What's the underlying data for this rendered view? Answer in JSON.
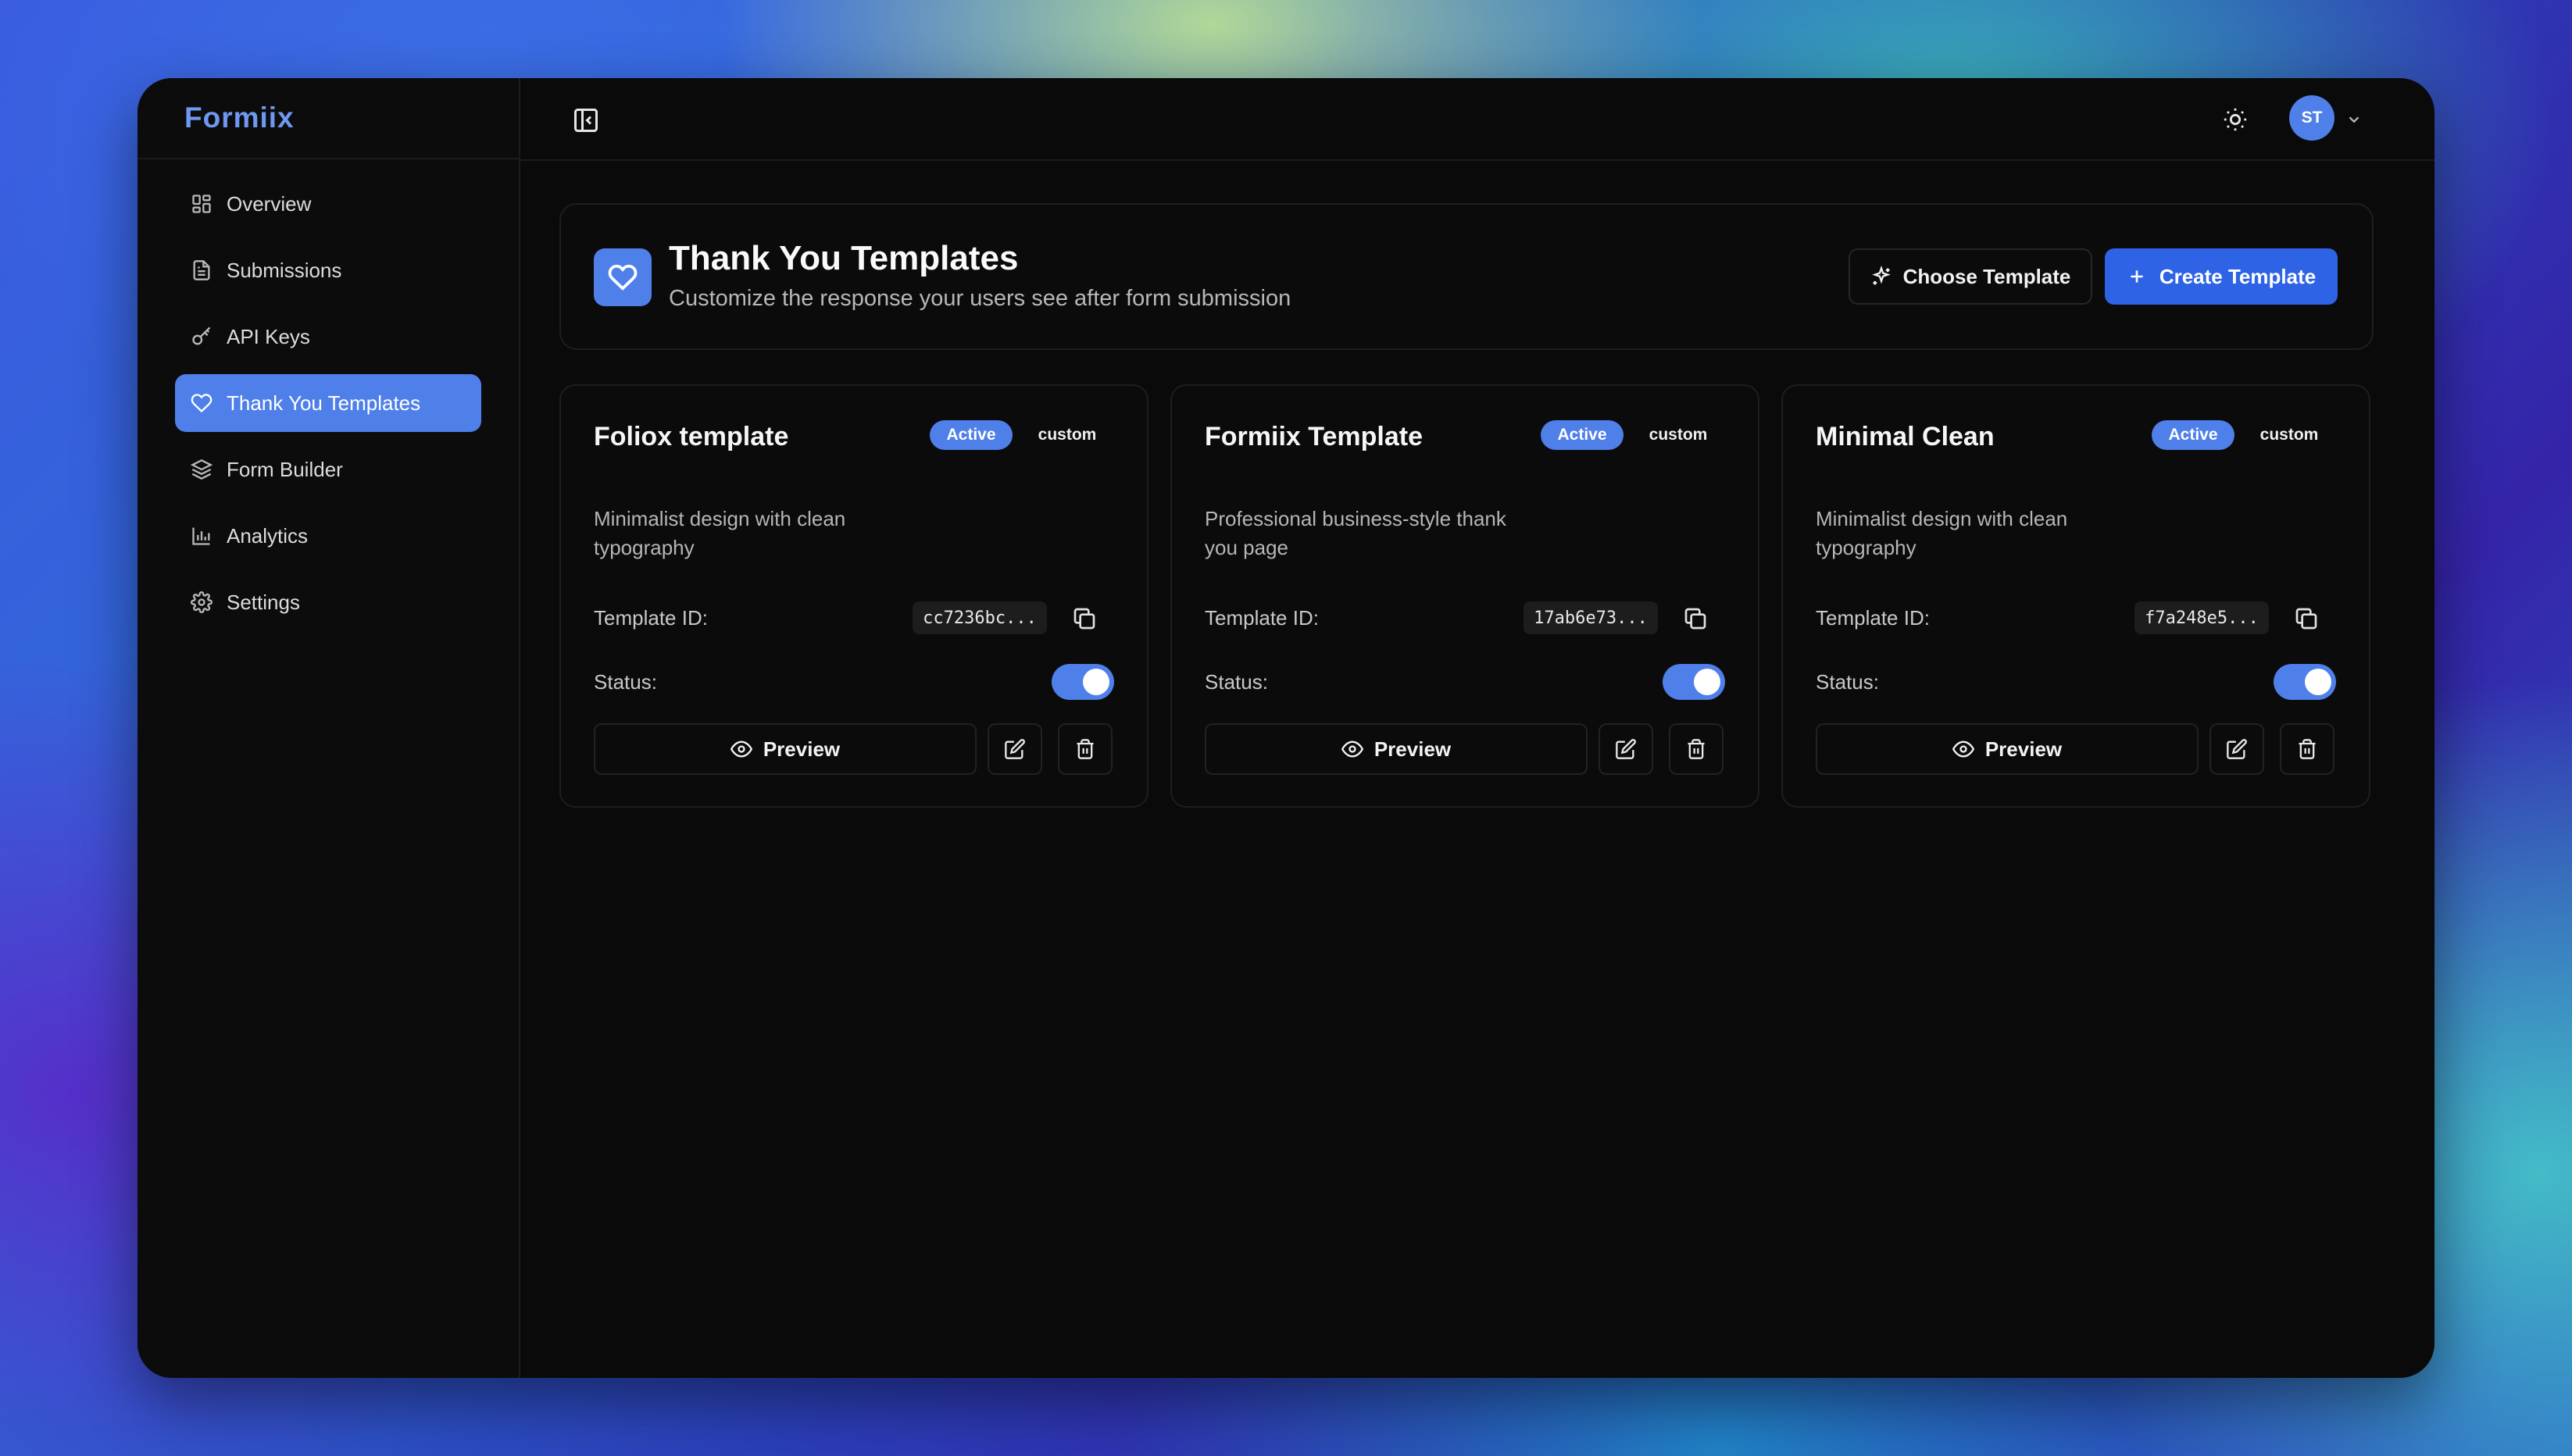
{
  "app": {
    "brand": "Formiix"
  },
  "sidebar": {
    "items": [
      {
        "label": "Overview",
        "icon": "grid-icon",
        "active": false
      },
      {
        "label": "Submissions",
        "icon": "document-icon",
        "active": false
      },
      {
        "label": "API Keys",
        "icon": "key-icon",
        "active": false
      },
      {
        "label": "Thank You Templates",
        "icon": "heart-icon",
        "active": true
      },
      {
        "label": "Form Builder",
        "icon": "layers-icon",
        "active": false
      },
      {
        "label": "Analytics",
        "icon": "bar-chart-icon",
        "active": false
      },
      {
        "label": "Settings",
        "icon": "gear-icon",
        "active": false
      }
    ]
  },
  "topbar": {
    "avatar_initials": "ST",
    "theme_icon": "sun-icon"
  },
  "header": {
    "title": "Thank You Templates",
    "subtitle": "Customize the response your users see after form submission",
    "choose_label": "Choose Template",
    "create_label": "Create Template"
  },
  "labels": {
    "template_id": "Template ID:",
    "status": "Status:",
    "preview": "Preview"
  },
  "templates": [
    {
      "name": "Foliox template",
      "active_badge": "Active",
      "type_badge": "custom",
      "description": "Minimalist design with clean typography",
      "id": "cc7236bc...",
      "enabled": true
    },
    {
      "name": "Formiix Template",
      "active_badge": "Active",
      "type_badge": "custom",
      "description": "Professional business-style thank you page",
      "id": "17ab6e73...",
      "enabled": true
    },
    {
      "name": "Minimal Clean",
      "active_badge": "Active",
      "type_badge": "custom",
      "description": "Minimalist design with clean typography",
      "id": "f7a248e5...",
      "enabled": true
    }
  ],
  "colors": {
    "accent": "#4f7fe8",
    "primary_button": "#2e63e6",
    "background": "#0a0a0a"
  }
}
